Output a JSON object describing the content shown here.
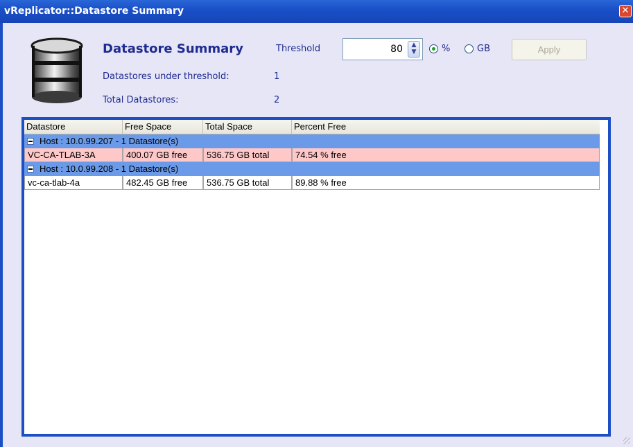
{
  "window": {
    "title": "vReplicator::Datastore Summary",
    "close_glyph": "✕"
  },
  "summary": {
    "heading": "Datastore Summary",
    "under_threshold_label": "Datastores under threshold:",
    "under_threshold_value": "1",
    "total_label": "Total Datastores:",
    "total_value": "2"
  },
  "threshold": {
    "label": "Threshold",
    "value": "80",
    "unit_options": [
      {
        "label": "%",
        "selected": true
      },
      {
        "label": "GB",
        "selected": false
      }
    ],
    "apply_label": "Apply"
  },
  "grid": {
    "columns": [
      "Datastore",
      "Free Space",
      "Total Space",
      "Percent Free"
    ],
    "groups": [
      {
        "header": "Host : 10.0.99.207 - 1 Datastore(s)",
        "rows": [
          {
            "cells": [
              "VC-CA-TLAB-3A",
              "400.07 GB free",
              "536.75 GB total",
              "74.54 % free"
            ],
            "under_threshold": true
          }
        ]
      },
      {
        "header": "Host : 10.0.99.208 - 1 Datastore(s)",
        "rows": [
          {
            "cells": [
              "vc-ca-tlab-4a",
              "482.45 GB free",
              "536.75 GB total",
              "89.88 % free"
            ],
            "under_threshold": false
          }
        ]
      }
    ]
  },
  "colors": {
    "titlebar": "#1A50C8",
    "group_row": "#6A9AE8",
    "alert_row": "#FFC8C8",
    "text_accent": "#1F2B8F"
  },
  "icons": {
    "app": "database-icon",
    "spinner": "spinner-arrows-icon",
    "expander": "collapse-minus-icon"
  }
}
